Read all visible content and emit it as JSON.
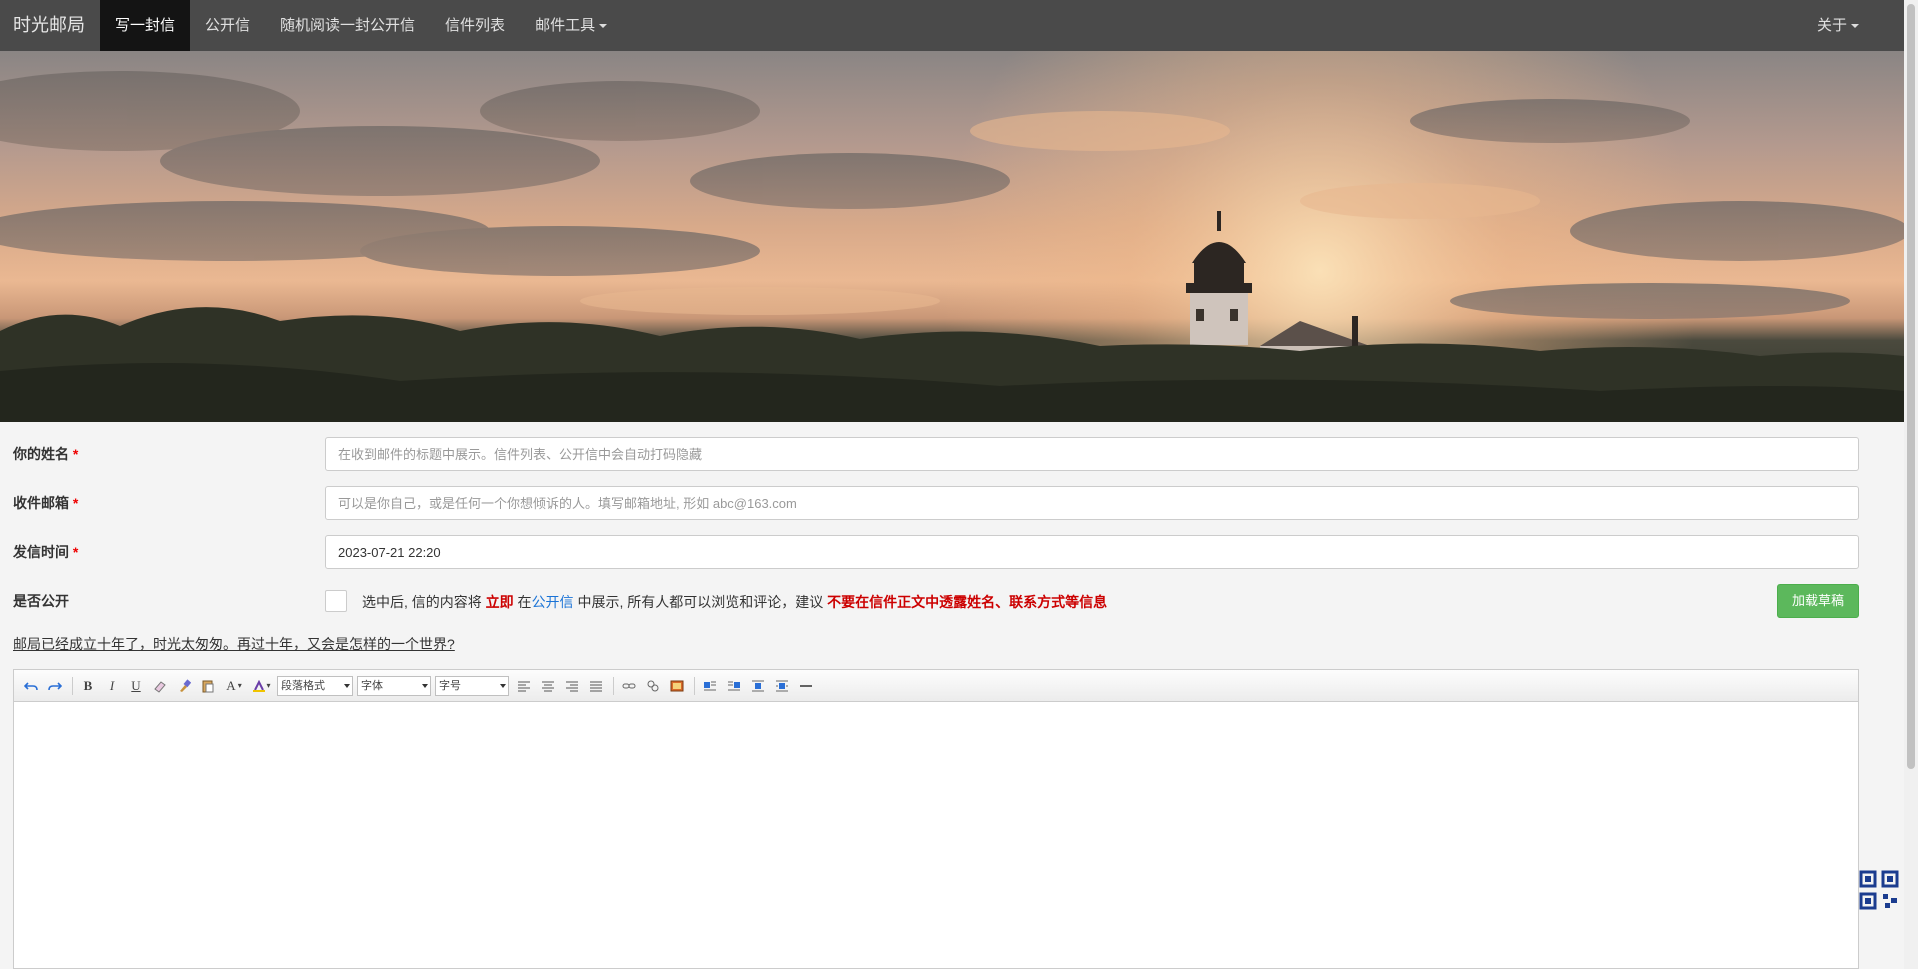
{
  "nav": {
    "brand": "时光邮局",
    "items": [
      "写一封信",
      "公开信",
      "随机阅读一封公开信",
      "信件列表"
    ],
    "tools_label": "邮件工具",
    "about_label": "关于"
  },
  "form": {
    "name_label": "你的姓名",
    "name_placeholder": "在收到邮件的标题中展示。信件列表、公开信中会自动打码隐藏",
    "email_label": "收件邮箱",
    "email_placeholder": "可以是你自己，或是任何一个你想倾诉的人。填写邮箱地址, 形如 abc@163.com",
    "time_label": "发信时间",
    "time_value": "2023-07-21 22:20",
    "required_mark": "*",
    "public_label": "是否公开",
    "public_text_1": "选中后, 信的内容将 ",
    "public_text_immediate": "立即",
    "public_text_2": " 在",
    "public_text_link": "公开信",
    "public_text_3": " 中展示, 所有人都可以浏览和评论，建议 ",
    "public_text_warning": "不要在信件正文中透露姓名、联系方式等信息",
    "draft_button": "加载草稿"
  },
  "tagline": "邮局已经成立十年了，时光太匆匆。再过十年，又会是怎样的一个世界?",
  "toolbar": {
    "paragraph_select": "段落格式",
    "font_select": "字体",
    "size_select": "字号"
  }
}
